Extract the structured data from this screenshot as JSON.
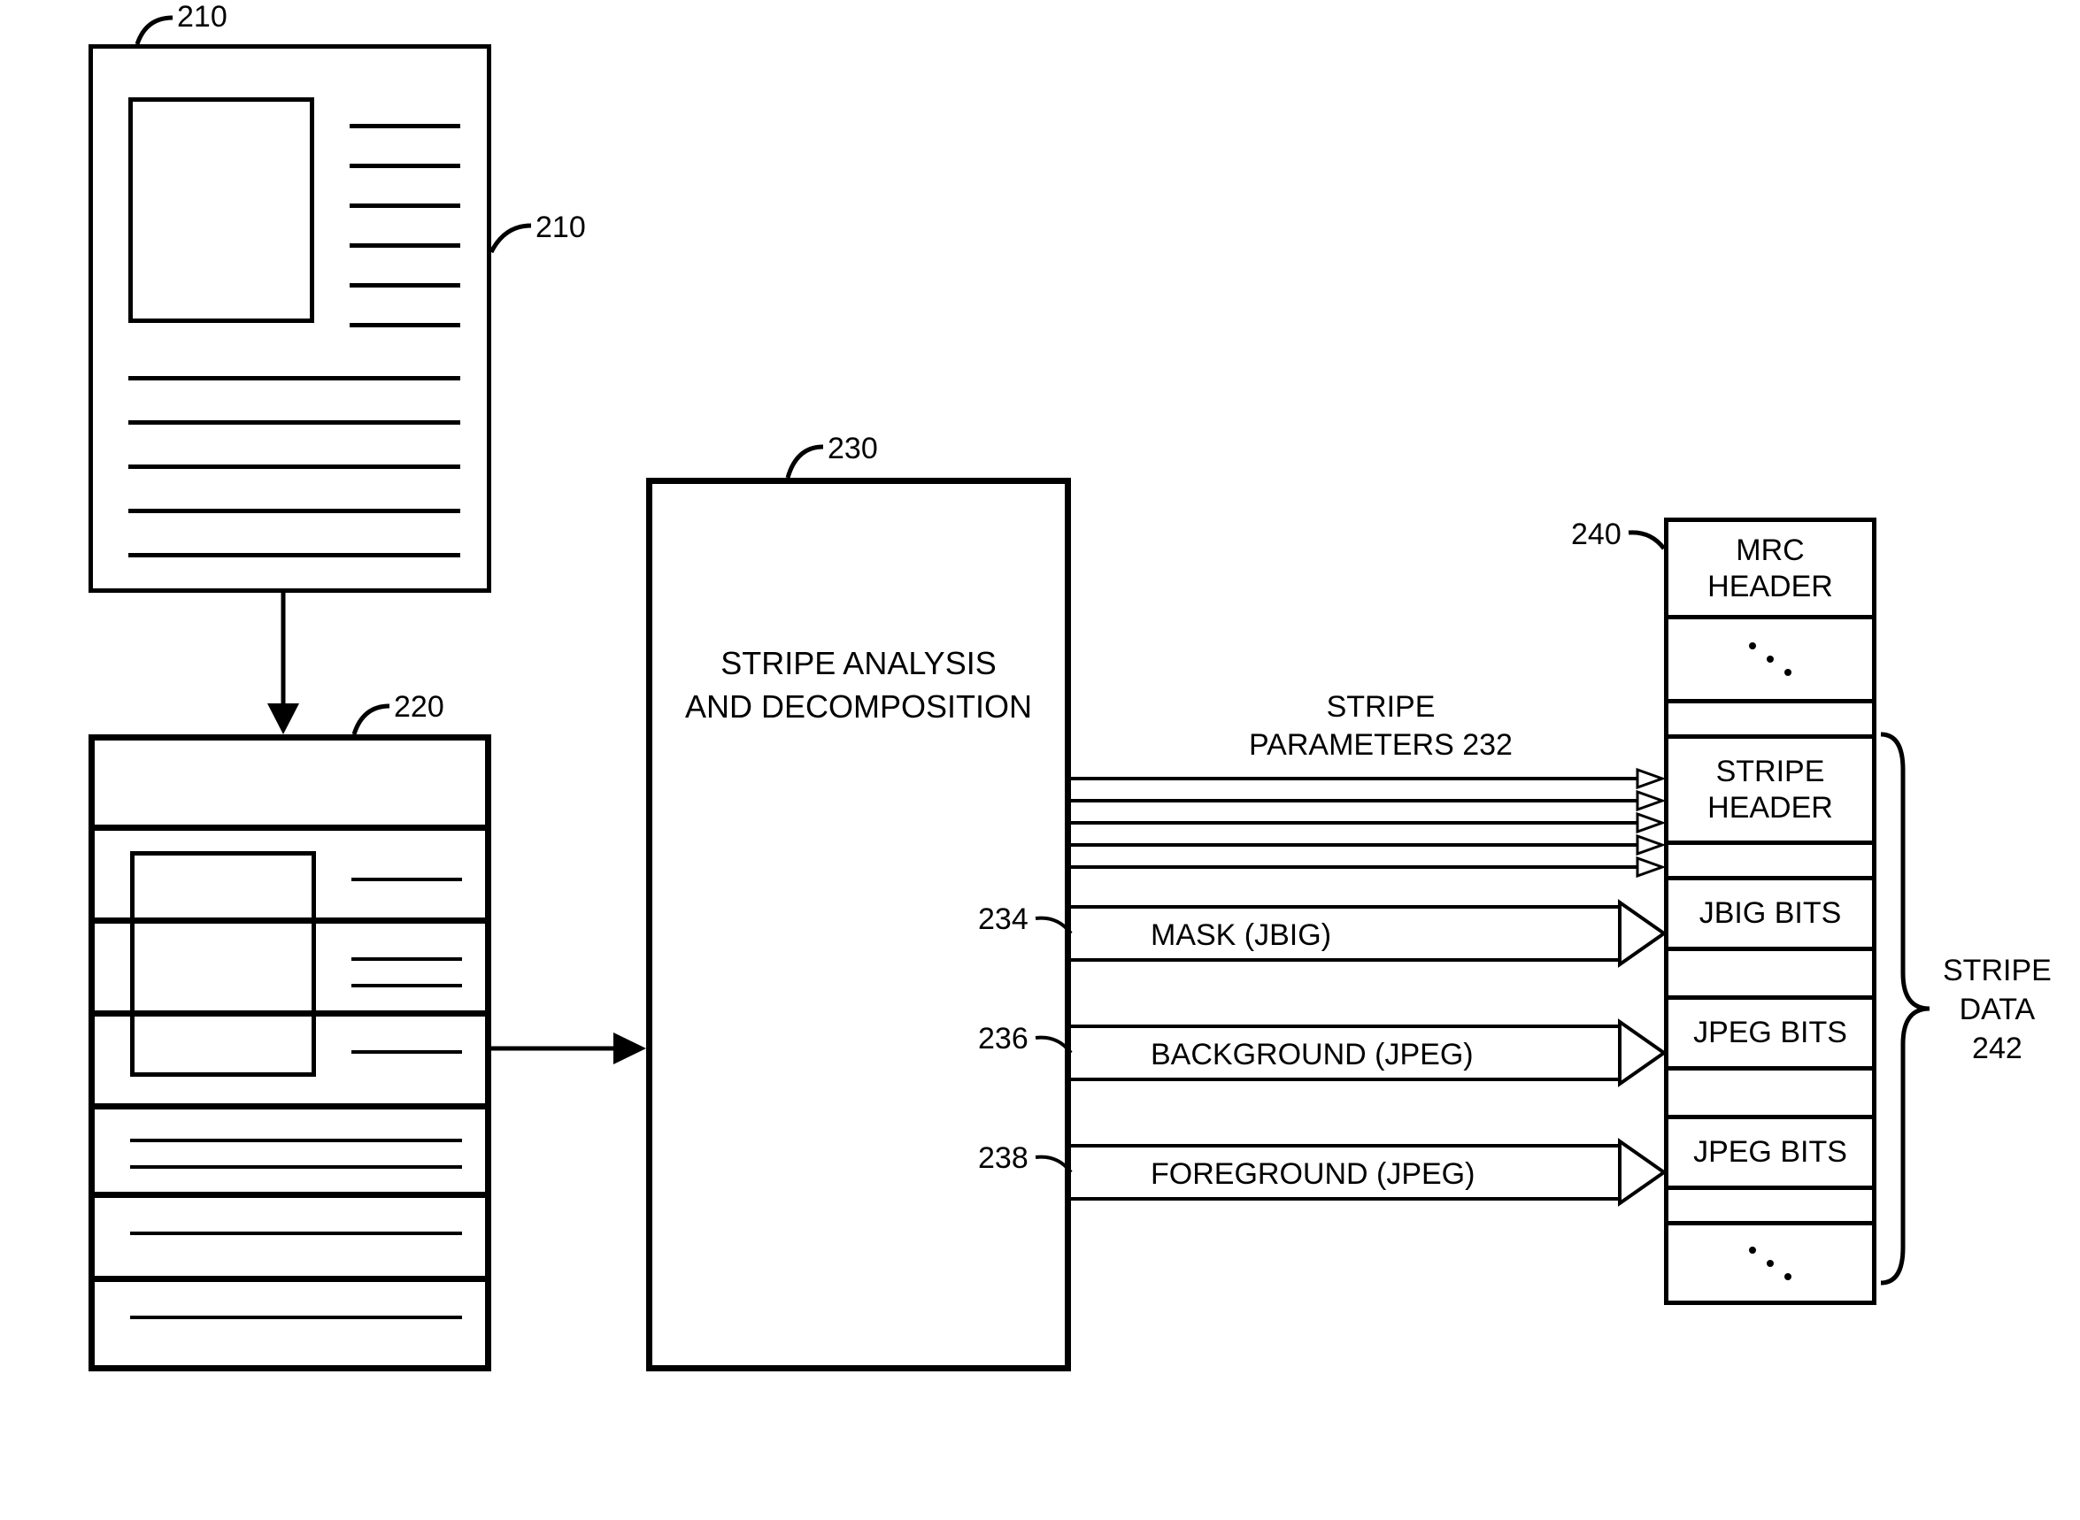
{
  "refs": {
    "doc_outer": "210",
    "doc_inner": "210",
    "stripes": "220",
    "analysis": "230",
    "params_label": "STRIPE\nPARAMETERS 232",
    "mask_ref": "234",
    "bg_ref": "236",
    "fg_ref": "238",
    "output_ref": "240"
  },
  "analysis_block": "STRIPE ANALYSIS\nAND DECOMPOSITION",
  "mask_label": "MASK (JBIG)",
  "bg_label": "BACKGROUND (JPEG)",
  "fg_label": "FOREGROUND (JPEG)",
  "out": {
    "mrc_header": "MRC\nHEADER",
    "stripe_header": "STRIPE\nHEADER",
    "jbig_bits": "JBIG BITS",
    "jpeg_bits1": "JPEG BITS",
    "jpeg_bits2": "JPEG BITS"
  },
  "stripe_data_label": "STRIPE\nDATA\n242"
}
